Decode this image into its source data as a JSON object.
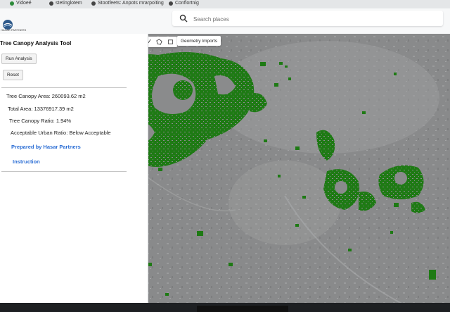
{
  "browser": {
    "tabs": [
      {
        "label": "Vidoeé"
      },
      {
        "label": "stetinglotem"
      },
      {
        "label": "Stootfeets: Anpots mrarpoiting"
      },
      {
        "label": "Conflortnig"
      }
    ]
  },
  "header": {
    "logo_text": "HASAR PARTNERS",
    "search_placeholder": "Search places"
  },
  "panel": {
    "title": "Tree Canopy Analysis Tool",
    "run_label": "Run Analysis",
    "reset_label": "Reset",
    "stats": [
      {
        "label": "Tree Canopy Area: 260093.62 m2"
      },
      {
        "label": "Total Area: 13376917.39 m2"
      },
      {
        "label": "Tree Canopy Ratio: 1.94%"
      },
      {
        "label": "Acceptable Urban Ratio: Below Acceptable"
      }
    ],
    "links": {
      "prepared": "Prepared by Hasar Partners",
      "instruction": "Instruction"
    }
  },
  "map": {
    "geometry_imports_label": "Geometry Imports",
    "zoom_in": "+",
    "zoom_out": "−",
    "canopy_color": "#1e7a14",
    "background_color": "#8a8b8c",
    "tools": [
      "hand-icon",
      "marker-icon",
      "polyline-icon",
      "polygon-icon",
      "rectangle-icon"
    ]
  }
}
